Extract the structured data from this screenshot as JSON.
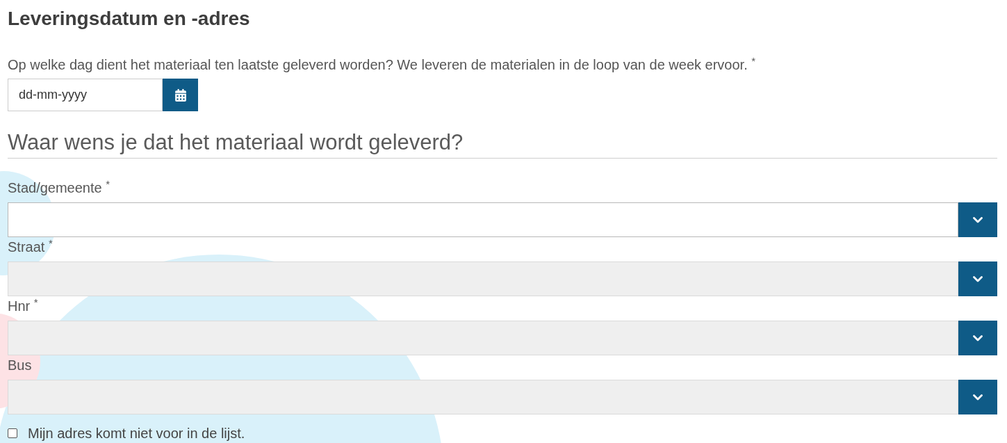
{
  "section_title": "Leveringsdatum en -adres",
  "delivery_date": {
    "label": "Op welke dag dient het materiaal ten laatste geleverd worden? We leveren de materialen in de loop van de week ervoor. $^{*}$",
    "placeholder": "dd-mm-yyyy"
  },
  "address": {
    "title": "Waar wens je dat het materiaal wordt geleverd?",
    "fields": [
      {
        "label": "Stad/gemeente $^{*}$",
        "disabled": false
      },
      {
        "label": "Straat $^{*}$",
        "disabled": true
      },
      {
        "label": "Hnr $^{*}$",
        "disabled": true
      },
      {
        "label": "Bus",
        "disabled": true
      }
    ],
    "not_listed": {
      "label": "Mijn adres komt niet voor in de lijst.",
      "checked": false
    }
  }
}
